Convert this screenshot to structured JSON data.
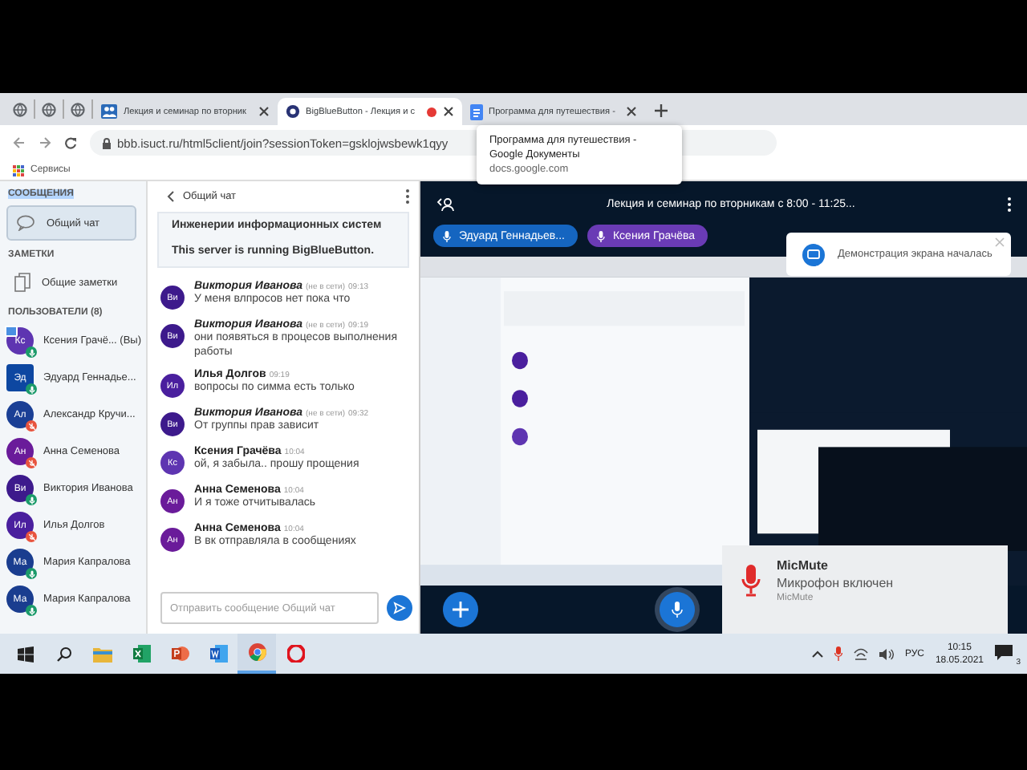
{
  "browser": {
    "tabs": [
      {
        "kind": "pinned",
        "selected": false,
        "recording": false
      },
      {
        "kind": "pinned",
        "selected": false,
        "recording": false
      },
      {
        "kind": "pinned",
        "selected": false,
        "recording": false
      },
      {
        "kind": "page",
        "label": "Лекция и семинар по вторник",
        "selected": false,
        "recording": false
      },
      {
        "kind": "page",
        "label": "BigBlueButton - Лекция и с",
        "selected": true,
        "recording": true
      },
      {
        "kind": "page",
        "label": "Программа для путешествия -",
        "selected": false,
        "recording": false
      }
    ],
    "address": "bbb.isuct.ru/html5client/join?sessionToken=gsklojwsbewk1qyy",
    "bookmarks": [
      "Сервисы"
    ],
    "tooltip": {
      "title": "Программа для путешествия - Google Документы",
      "url": "docs.google.com"
    }
  },
  "sidebar": {
    "messages_heading": "СООБЩЕНИЯ",
    "chat_item": {
      "label": "Общий чат",
      "selected": true
    },
    "notes_heading": "ЗАМЕТКИ",
    "notes_item": "Общие заметки",
    "users_heading": "ПОЛЬЗОВАТЕЛИ (8)",
    "users": [
      {
        "initials": "Кс",
        "name": "Ксения Грачё...",
        "suffix": "(Вы)",
        "color": "#5e35b1",
        "muted": false,
        "moderator": false,
        "presenter": true
      },
      {
        "initials": "Эд",
        "name": "Эдуард Геннадье...",
        "color": "#0d47a1",
        "muted": false,
        "moderator": true,
        "presenter": false
      },
      {
        "initials": "Ал",
        "name": "Александр Кручи...",
        "color": "#1a3f95",
        "muted": true,
        "moderator": false,
        "presenter": false
      },
      {
        "initials": "Ан",
        "name": "Анна Семенова",
        "color": "#6a1b9a",
        "muted": true,
        "moderator": false,
        "presenter": false
      },
      {
        "initials": "Ви",
        "name": "Виктория Иванова",
        "color": "#3d1a8c",
        "muted": false,
        "moderator": false,
        "presenter": false
      },
      {
        "initials": "Ил",
        "name": "Илья Долгов",
        "color": "#4a1f9e",
        "muted": true,
        "moderator": false,
        "presenter": false
      },
      {
        "initials": "Ма",
        "name": "Мария Капралова",
        "color": "#1a3d8f",
        "muted": false,
        "moderator": false,
        "presenter": false
      },
      {
        "initials": "Ма",
        "name": "Мария Капралова",
        "color": "#1a3d8f",
        "muted": false,
        "moderator": false,
        "presenter": false
      }
    ]
  },
  "chat": {
    "title": "Общий чат",
    "welcome": "Инженерии информационных систем",
    "server_note": "This server is running **BigBlueButton**.",
    "messages": [
      {
        "initials": "Ви",
        "color": "#3d1a8c",
        "name": "Виктория Иванова",
        "offline": true,
        "status": "(не в сети)",
        "time": "09:13",
        "text": "У меня влпросов нет пока что"
      },
      {
        "initials": "Ви",
        "color": "#3d1a8c",
        "name": "Виктория Иванова",
        "offline": true,
        "status": "(не в сети)",
        "time": "09:19",
        "text": "они появяться в процесов выполнения работы"
      },
      {
        "initials": "Ил",
        "color": "#4a1f9e",
        "name": "Илья Долгов",
        "offline": false,
        "time": "09:19",
        "text": "вопросы по симма есть только"
      },
      {
        "initials": "Ви",
        "color": "#3d1a8c",
        "name": "Виктория Иванова",
        "offline": true,
        "status": "(не в сети)",
        "time": "09:32",
        "text": "От группы прав зависит"
      },
      {
        "initials": "Кс",
        "color": "#5e35b1",
        "name": "Ксения Грачёва",
        "offline": false,
        "time": "10:04",
        "text": "ой, я забыла.. прошу прощения"
      },
      {
        "initials": "Ан",
        "color": "#6a1b9a",
        "name": "Анна Семенова",
        "offline": false,
        "time": "10:04",
        "text": "И я тоже отчитывалась"
      },
      {
        "initials": "Ан",
        "color": "#6a1b9a",
        "name": "Анна Семенова",
        "offline": false,
        "time": "10:04",
        "text": "В вк отправляла в сообщениях"
      }
    ],
    "input": {
      "placeholder": "Отправить сообщение Общий чат"
    }
  },
  "main": {
    "title": "Лекция и семинар по вторникам с 8:00 - 11:25...",
    "talkers": [
      {
        "name": "Эдуард Геннадьев...",
        "color": "#1565c0"
      },
      {
        "name": "Ксения Грачёва",
        "color": "#6a3bb5"
      }
    ],
    "toast": "Демонстрация экрана началась",
    "micmute": {
      "app": "MicMute",
      "message": "Микрофон включен",
      "source": "MicMute"
    }
  },
  "taskbar": {
    "apps": [
      {
        "kind": "start",
        "active": false
      },
      {
        "kind": "search",
        "active": false
      },
      {
        "kind": "explorer",
        "active": false
      },
      {
        "kind": "excel",
        "active": false
      },
      {
        "kind": "powerpoint",
        "active": false
      },
      {
        "kind": "word",
        "active": false
      },
      {
        "kind": "chrome",
        "active": true
      },
      {
        "kind": "opera",
        "active": false
      }
    ],
    "language": "РУС",
    "time": "10:15",
    "date": "18.05.2021",
    "notifications": "3"
  }
}
